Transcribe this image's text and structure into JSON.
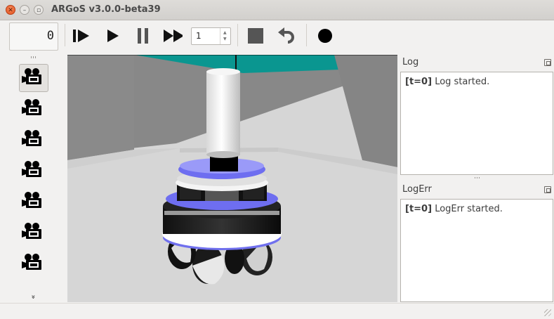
{
  "window": {
    "title": "ARGoS v3.0.0-beta39"
  },
  "toolbar": {
    "step_counter": "0",
    "speed_value": "1"
  },
  "cameras": {
    "items": [
      {
        "name": "camera-1",
        "selected": true
      },
      {
        "name": "camera-2",
        "selected": false
      },
      {
        "name": "camera-3",
        "selected": false
      },
      {
        "name": "camera-4",
        "selected": false
      },
      {
        "name": "camera-5",
        "selected": false
      },
      {
        "name": "camera-6",
        "selected": false
      },
      {
        "name": "camera-7",
        "selected": false
      }
    ],
    "more_glyph": "»"
  },
  "log": {
    "title": "Log",
    "entries": [
      {
        "prefix": "[t=0]",
        "message": "Log started."
      }
    ]
  },
  "logerr": {
    "title": "LogErr",
    "entries": [
      {
        "prefix": "[t=0]",
        "message": "LogErr started."
      }
    ]
  },
  "colors": {
    "ceiling": "#0a9690",
    "floor": "#d6d6d6",
    "robot_blue": "#6e6ef0",
    "close_button": "#e2521c"
  }
}
